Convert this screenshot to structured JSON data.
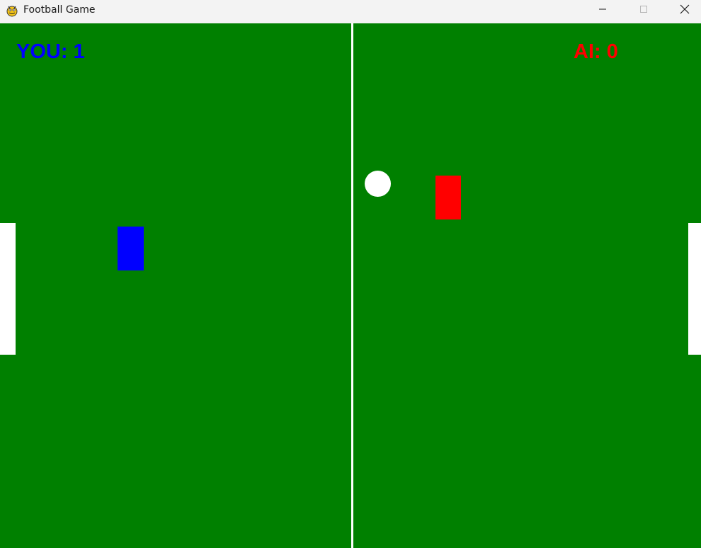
{
  "window": {
    "title": "Football Game",
    "app_icon": "pygame-snake-icon",
    "controls": {
      "minimize_icon": "minimize-icon",
      "maximize_icon": "maximize-icon",
      "close_icon": "close-icon"
    }
  },
  "game": {
    "score_you_text": "YOU: 1",
    "score_ai_text": "AI: 0",
    "colors": {
      "field": "#008000",
      "lines": "#ffffff",
      "player": "#0000ff",
      "ai": "#ff0000",
      "ball": "#ffffff",
      "goal": "#ffffff"
    }
  }
}
